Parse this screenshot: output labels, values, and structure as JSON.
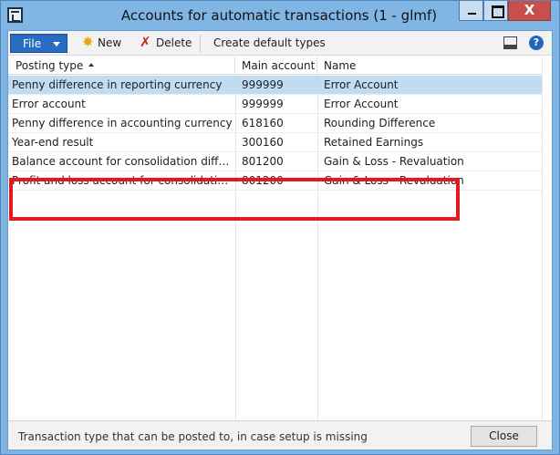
{
  "window": {
    "title": "Accounts for automatic transactions (1 - glmf)",
    "close_glyph": "X"
  },
  "toolbar": {
    "file_label": "File",
    "new_label": "New",
    "delete_label": "Delete",
    "create_default_types_label": "Create default types",
    "help_glyph": "?"
  },
  "icons": {
    "app": "app-window-icon",
    "new": "sun-star-icon",
    "delete": "red-x-icon",
    "layout": "layout-panel-icon",
    "help": "help-icon"
  },
  "grid": {
    "columns": [
      "Posting type",
      "Main account",
      "Name"
    ],
    "sort_column": "Posting type",
    "rows": [
      {
        "posting_type": "Penny difference in reporting currency",
        "main_account": "999999",
        "name": "Error Account",
        "selected": true
      },
      {
        "posting_type": "Error account",
        "main_account": "999999",
        "name": "Error Account"
      },
      {
        "posting_type": "Penny difference in accounting currency",
        "main_account": "618160",
        "name": "Rounding Difference"
      },
      {
        "posting_type": "Year-end result",
        "main_account": "300160",
        "name": "Retained Earnings"
      },
      {
        "posting_type": "Balance account for consolidation differences",
        "main_account": "801200",
        "name": "Gain & Loss - Revaluation"
      },
      {
        "posting_type": "Profit and loss account for consolidation diff...",
        "main_account": "801200",
        "name": "Gain & Loss - Revaluation"
      }
    ]
  },
  "status": {
    "text": "Transaction type that can be posted to, in case setup is missing",
    "close_label": "Close"
  },
  "colors": {
    "accent": "#2a6cc2",
    "title_bar": "#80b6e4",
    "selection": "#bfdcf3",
    "highlight": "#e21a1f"
  }
}
